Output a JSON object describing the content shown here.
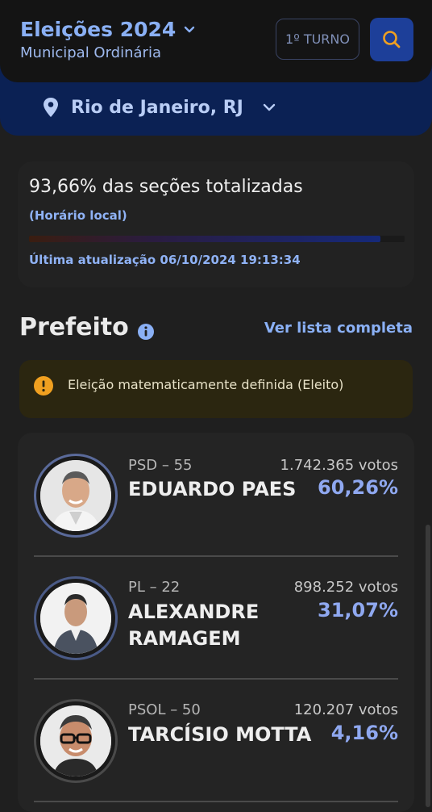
{
  "header": {
    "title": "Eleições 2024",
    "subtitle": "Municipal Ordinária",
    "turno_label": "1º TURNO",
    "location": "Rio de Janeiro, RJ"
  },
  "totalization": {
    "percent_text": "93,66% das seções totalizadas",
    "timezone_note": "(Horário local)",
    "progress": 0.9366,
    "last_update": "Última atualização 06/10/2024 19:13:34"
  },
  "section": {
    "title": "Prefeito",
    "view_all": "Ver lista completa",
    "status_banner": "Eleição matematicamente definida (Eleito)"
  },
  "candidates": [
    {
      "party": "PSD – 55",
      "votes": "1.742.365 votos",
      "name": "EDUARDO PAES",
      "percent": "60,26%"
    },
    {
      "party": "PL – 22",
      "votes": "898.252 votos",
      "name": "ALEXANDRE RAMAGEM",
      "percent": "31,07%"
    },
    {
      "party": "PSOL – 50",
      "votes": "120.207 votos",
      "name": "TARCÍSIO MOTTA",
      "percent": "4,16%"
    }
  ],
  "colors": {
    "accent": "#8ab0f5",
    "search_button": "#1d3f99",
    "location_bar": "#0b2154",
    "banner_bg": "#2b2610",
    "banner_icon": "#f0a020"
  },
  "icons": [
    "chevron-down-icon",
    "search-icon",
    "location-pin-icon",
    "info-icon",
    "alert-icon"
  ]
}
